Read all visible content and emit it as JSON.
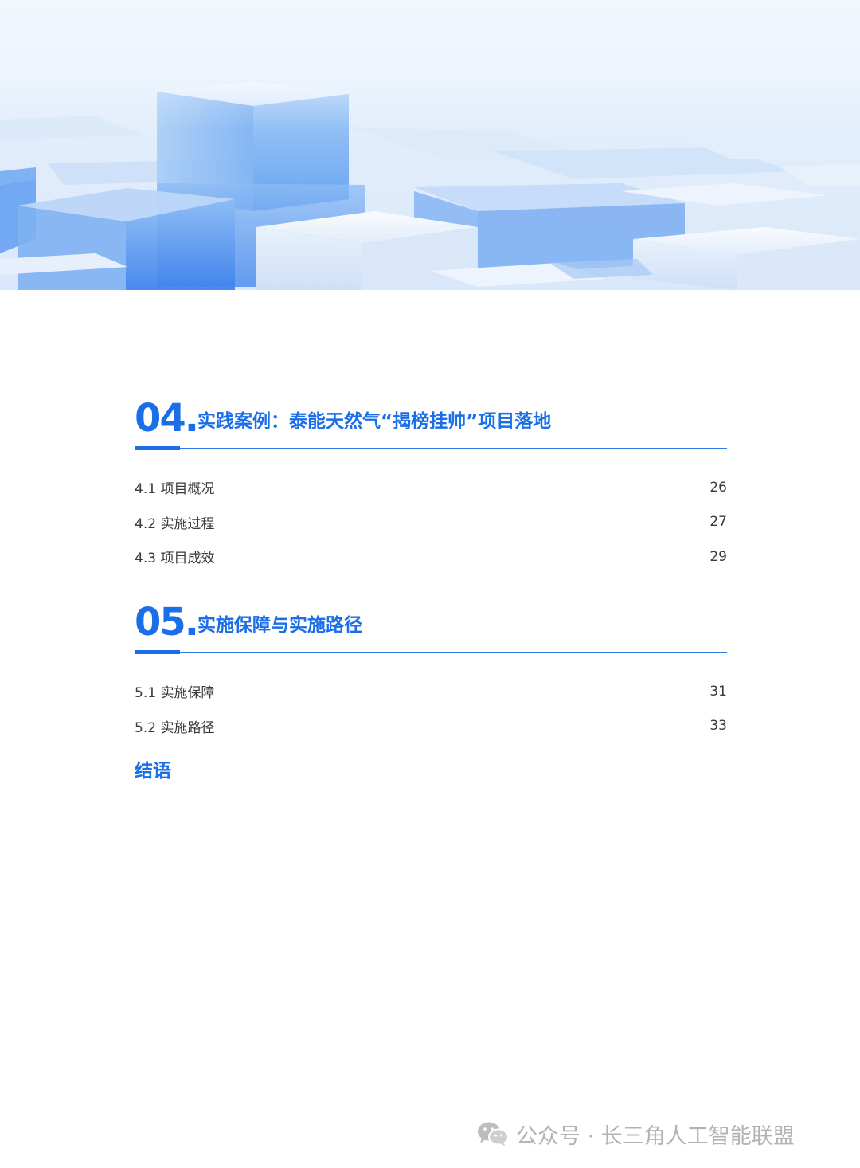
{
  "hero": {
    "image": "blue-glass-cubes-banner"
  },
  "sections": [
    {
      "number": "04.",
      "title": "实践案例：泰能天然气“揭榜挂帅”项目落地",
      "items": [
        {
          "label": "4.1 项目概况",
          "page": "26"
        },
        {
          "label": "4.2 实施过程",
          "page": "27"
        },
        {
          "label": "4.3 项目成效",
          "page": "29"
        }
      ]
    },
    {
      "number": "05.",
      "title": "实施保障与实施路径",
      "items": [
        {
          "label": "5.1 实施保障",
          "page": "31"
        },
        {
          "label": "5.2 实施路径",
          "page": "33"
        }
      ]
    }
  ],
  "ending": {
    "title": "结语"
  },
  "watermark": {
    "icon": "wechat-icon",
    "text": "公众号 · 长三角人工智能联盟"
  },
  "colors": {
    "accent": "#1a6ee8",
    "rule": "#2f7ce8",
    "text": "#3a3a3a",
    "watermark": "#b3b3b3"
  }
}
